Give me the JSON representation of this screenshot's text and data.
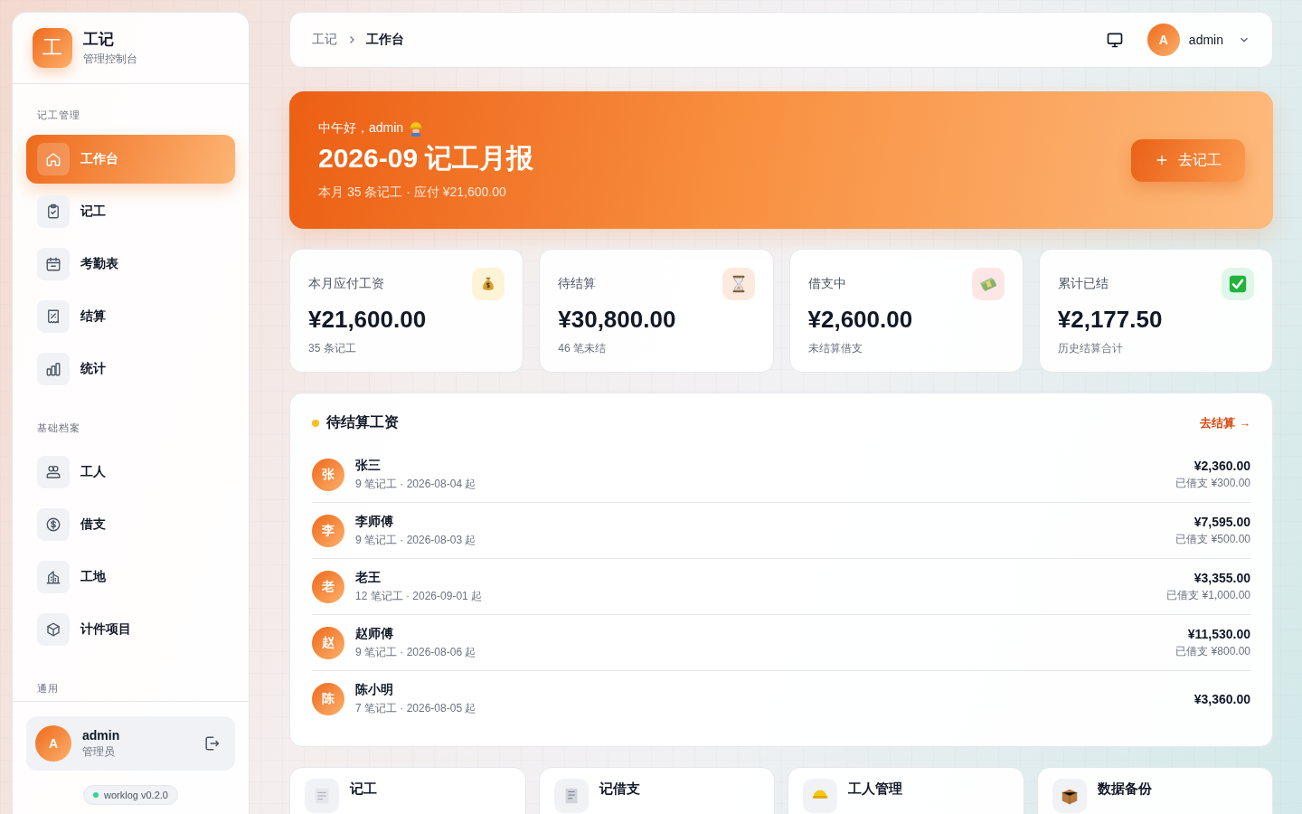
{
  "sidebar": {
    "logo": "工",
    "title": "工记",
    "subtitle": "管理控制台",
    "sections": [
      {
        "label": "记工管理",
        "items": [
          {
            "label": "工作台",
            "selected": true
          },
          {
            "label": "记工",
            "selected": false
          },
          {
            "label": "考勤表",
            "selected": false
          },
          {
            "label": "结算",
            "selected": false
          },
          {
            "label": "统计",
            "selected": false
          }
        ]
      },
      {
        "label": "基础档案",
        "items": [
          {
            "label": "工人",
            "selected": false
          },
          {
            "label": "借支",
            "selected": false
          },
          {
            "label": "工地",
            "selected": false
          },
          {
            "label": "计件项目",
            "selected": false
          }
        ]
      },
      {
        "label": "通用"
      }
    ],
    "user": {
      "avatar": "A",
      "name": "admin",
      "role": "管理员"
    },
    "version": "worklog v0.2.0"
  },
  "topbar": {
    "breadcrumb": [
      "工记",
      "工作台"
    ],
    "user": {
      "avatar": "A",
      "name": "admin"
    }
  },
  "banner": {
    "greeting": "中午好，admin",
    "title": "2026-09 记工月报",
    "summary": "本月 35 条记工 · 应付 ¥21,600.00",
    "button": "去记工"
  },
  "stats": [
    {
      "label": "本月应付工资",
      "value": "¥21,600.00",
      "note": "35 条记工",
      "color": "#fdf3d6"
    },
    {
      "label": "待结算",
      "value": "¥30,800.00",
      "note": "46 笔未结",
      "color": "#fdeadf"
    },
    {
      "label": "借支中",
      "value": "¥2,600.00",
      "note": "未结算借支",
      "color": "#fde6e6"
    },
    {
      "label": "累计已结",
      "value": "¥2,177.50",
      "note": "历史结算合计",
      "color": "#dff6ea"
    }
  ],
  "pending": {
    "title": "待结算工资",
    "link": "去结算 →",
    "rows": [
      {
        "avatar": "张",
        "name": "张三",
        "meta": "9 笔记工 · 2026-08-04 起",
        "amount": "¥2,360.00",
        "borrowed": "已借支 ¥300.00"
      },
      {
        "avatar": "李",
        "name": "李师傅",
        "meta": "9 笔记工 · 2026-08-03 起",
        "amount": "¥7,595.00",
        "borrowed": "已借支 ¥500.00"
      },
      {
        "avatar": "老",
        "name": "老王",
        "meta": "12 笔记工 · 2026-09-01 起",
        "amount": "¥3,355.00",
        "borrowed": "已借支 ¥1,000.00"
      },
      {
        "avatar": "赵",
        "name": "赵师傅",
        "meta": "9 笔记工 · 2026-08-06 起",
        "amount": "¥11,530.00",
        "borrowed": "已借支 ¥800.00"
      },
      {
        "avatar": "陈",
        "name": "陈小明",
        "meta": "7 笔记工 · 2026-08-05 起",
        "amount": "¥3,360.00"
      }
    ]
  },
  "shortcuts": [
    {
      "label": "记工"
    },
    {
      "label": "记借支"
    },
    {
      "label": "工人管理"
    },
    {
      "label": "数据备份"
    }
  ]
}
